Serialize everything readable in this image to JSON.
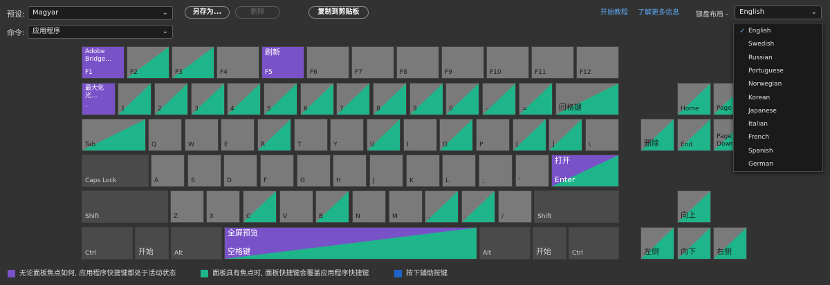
{
  "preset": {
    "label": "预设:",
    "value": "Magyar"
  },
  "save_as_label": "另存为...",
  "delete_label": "删除",
  "copy_clipboard_label": "复制到剪贴板",
  "getting_started": "开始教程",
  "learn_more": "了解更多信息",
  "layout_label": "键盘布局 -",
  "layout_value": "English",
  "command": {
    "label": "命令:",
    "value": "应用程序"
  },
  "languages": [
    "English",
    "Swedish",
    "Russian",
    "Portuguese",
    "Norwegian",
    "Korean",
    "Japanese",
    "Italian",
    "French",
    "Spanish",
    "German"
  ],
  "colors": {
    "purple": "#7a52c8",
    "green": "#1fb58b",
    "blue": "#1e64c8",
    "key": "#7a7a7a",
    "dark_key": "#4a4a4a"
  },
  "keys": {
    "f1": {
      "label": "F1",
      "cmd": "Adobe Bridge..."
    },
    "f2": "F2",
    "f3": "F3",
    "f4": "F4",
    "f5": {
      "label": "F5",
      "cmd": "刷新"
    },
    "f6": "F6",
    "f7": "F7",
    "f8": "F8",
    "f9": "F9",
    "f10": "F10",
    "f11": "F11",
    "f12": "F12",
    "backtick": {
      "label": "`",
      "cmd": "最大化光..."
    },
    "k1": "1",
    "k2": "2",
    "k3": "3",
    "k4": "4",
    "k5": "5",
    "k6": "6",
    "k7": "7",
    "k8": "8",
    "k9": "9",
    "k0": "0",
    "minus": "-",
    "equals": "=",
    "backspace": "回格键",
    "tab": "Tab",
    "q": "Q",
    "w": "W",
    "e": "E",
    "r": "R",
    "t": "T",
    "y": "Y",
    "u": "U",
    "i": "I",
    "o": "O",
    "p": "P",
    "lbracket": "[",
    "rbracket": "]",
    "backslash": "\\",
    "caps": "Caps Lock",
    "a": "A",
    "s": "S",
    "d": "D",
    "f": "F",
    "g": "G",
    "h": "H",
    "j": "J",
    "k": "K",
    "l": "L",
    "semicolon": ";",
    "quote": "'",
    "enter": {
      "label": "Enter",
      "cmd": "打开"
    },
    "lshift": "Shift",
    "z": "Z",
    "x": "X",
    "c": "C",
    "v": "V",
    "b": "B",
    "n": "N",
    "m": "M",
    "comma": ",",
    "period": ".",
    "slash": "/",
    "rshift": "Shift",
    "lctrl": "Ctrl",
    "lstart": "开始",
    "lalt": "Alt",
    "space": {
      "label": "空格键",
      "cmd": "全屏预览"
    },
    "ralt": "Alt",
    "rstart": "开始",
    "rctrl": "Ctrl",
    "home": "Home",
    "pageup": "Page Up",
    "del": "删除",
    "end": "End",
    "pagedown": "Page Down",
    "up": "向上",
    "left": "左侧",
    "down": "向下",
    "right": "右侧"
  },
  "legend": {
    "app_shortcut": "无论面板焦点如何, 应用程序快捷键都处于活动状态",
    "panel_shortcut": "面板具有焦点时, 面板快捷键会覆盖应用程序快捷键",
    "modifier": "按下辅助按键"
  }
}
